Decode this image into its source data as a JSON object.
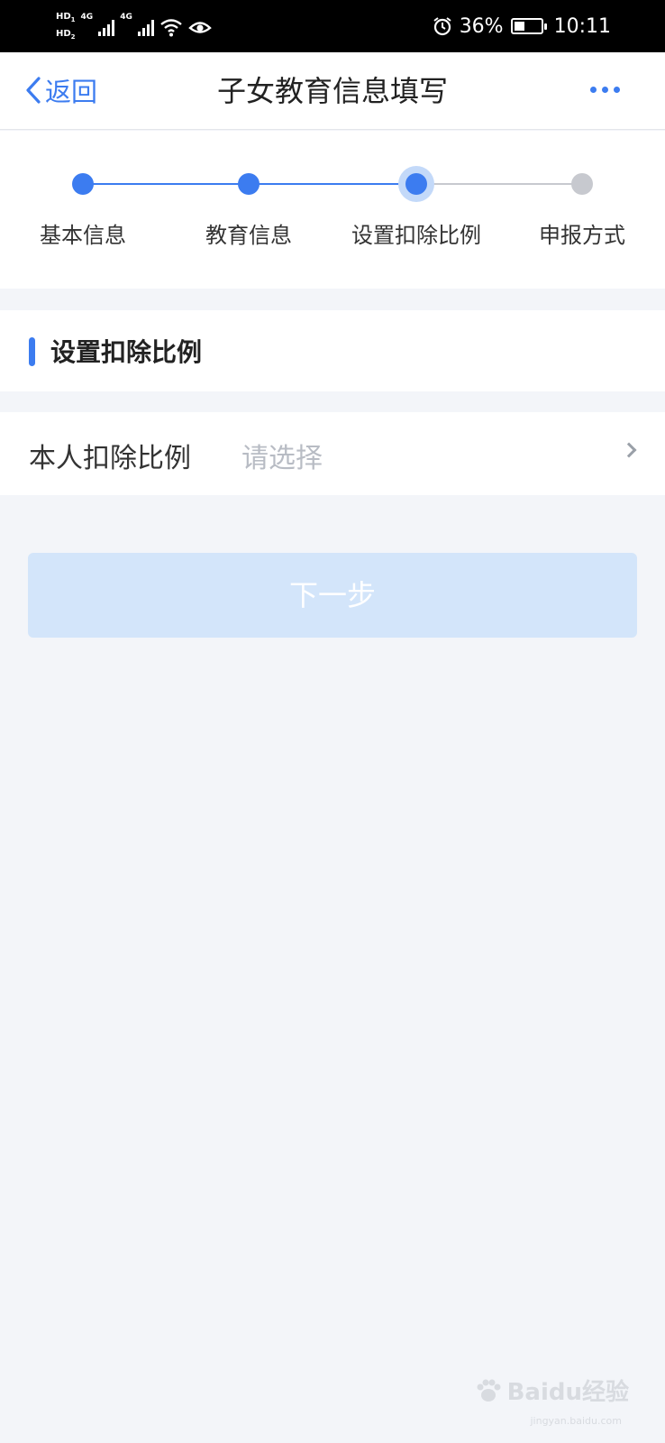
{
  "status_bar": {
    "sim1": "HD",
    "sim1_index": "1",
    "sim2": "HD",
    "sim2_index": "2",
    "network1": "4G",
    "network2": "4G",
    "battery_percent": "36%",
    "battery_level": 0.36,
    "time": "10:11",
    "icons": [
      "signal-icon",
      "wifi-icon",
      "eye-icon",
      "alarm-icon",
      "battery-icon"
    ]
  },
  "nav": {
    "back_label": "返回",
    "title": "子女教育信息填写",
    "more_icon": "more-dots-icon"
  },
  "stepper": {
    "steps": [
      {
        "label": "基本信息",
        "state": "done"
      },
      {
        "label": "教育信息",
        "state": "done"
      },
      {
        "label": "设置扣除比例",
        "state": "current"
      },
      {
        "label": "申报方式",
        "state": "pending"
      }
    ],
    "colors": {
      "active": "#3c7cf0",
      "pending": "#c7c9cf",
      "halo": "#c3d9f9"
    }
  },
  "section": {
    "title": "设置扣除比例"
  },
  "form": {
    "deduction_label": "本人扣除比例",
    "deduction_placeholder": "请选择"
  },
  "next_button": {
    "label": "下一步"
  },
  "watermark": {
    "brand": "Baidu经验",
    "domain": "jingyan.baidu.com"
  }
}
